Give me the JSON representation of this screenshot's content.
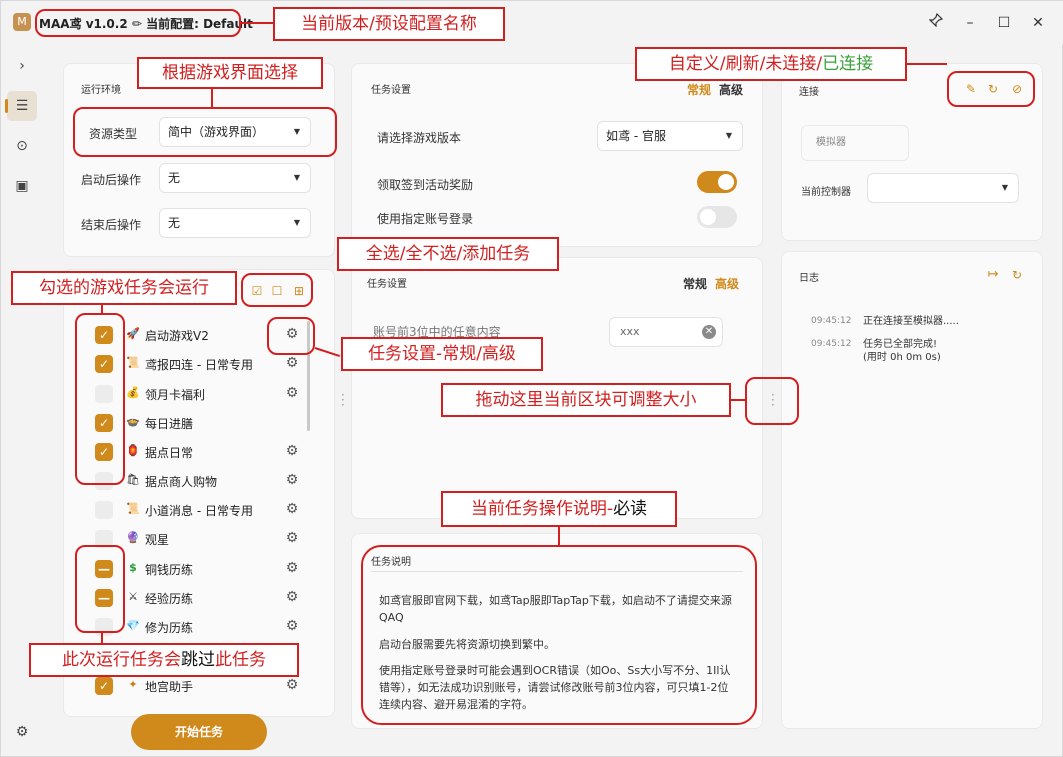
{
  "titlebar": {
    "logo_glyph": "M",
    "title": "MAA鸢  v1.0.2  ✏ 当前配置: Default",
    "pin_icon": "pin-icon",
    "min_glyph": "–",
    "max_glyph": "☐",
    "close_glyph": "✕"
  },
  "nav": {
    "expand_glyph": "›",
    "items": [
      {
        "icon": "task-list-icon",
        "glyph": "☰"
      },
      {
        "icon": "gamepad-icon",
        "glyph": "⊙"
      },
      {
        "icon": "screen-icon",
        "glyph": "▣"
      }
    ],
    "settings_glyph": "⚙"
  },
  "env": {
    "title": "运行环境",
    "resource_label": "资源类型",
    "resource_value": "简中（游戏界面）",
    "after_start_label": "启动后操作",
    "after_start_value": "无",
    "after_end_label": "结束后操作",
    "after_end_value": "无"
  },
  "task_settings_top": {
    "title": "任务设置",
    "mode_normal": "常规",
    "mode_advanced": "高级",
    "version_label": "请选择游戏版本",
    "version_value": "如鸢 - 官服",
    "reward_label": "领取签到活动奖励",
    "account_label": "使用指定账号登录"
  },
  "task_settings_bottom": {
    "title": "任务设置",
    "mode_normal": "常规",
    "mode_advanced": "高级",
    "account_prefix_label": "账号前3位中的任意内容",
    "account_prefix_value": "xxx"
  },
  "connection": {
    "title": "连接",
    "emulator": "模拟器",
    "controller_label": "当前控制器",
    "controller_value": ""
  },
  "log": {
    "title": "日志",
    "entries": [
      {
        "time": "09:45:12",
        "msg": "正在连接至模拟器....."
      },
      {
        "time": "09:45:12",
        "msg": "任务已全部完成!"
      }
    ],
    "sub_msg": "(用时 0h 0m 0s)"
  },
  "tasks": [
    {
      "name": "启动游戏V2",
      "state": "checked",
      "icon": "rocket-icon",
      "glyph": "🚀",
      "gear": true
    },
    {
      "name": "鸢报四连 - 日常专用",
      "state": "checked",
      "icon": "scroll-icon",
      "glyph": "📜",
      "gear": true
    },
    {
      "name": "领月卡福利",
      "state": "unchecked",
      "icon": "gift-icon",
      "glyph": "💰",
      "gear": true
    },
    {
      "name": "每日进膳",
      "state": "checked",
      "icon": "food-icon",
      "glyph": "🍲",
      "gear": false
    },
    {
      "name": "据点日常",
      "state": "checked",
      "icon": "lantern-icon",
      "glyph": "🏮",
      "gear": true
    },
    {
      "name": "据点商人购物",
      "state": "unchecked",
      "icon": "shop-icon",
      "glyph": "🛍",
      "gear": true
    },
    {
      "name": "小道消息 - 日常专用",
      "state": "unchecked",
      "icon": "note-icon",
      "glyph": "📜",
      "gear": true
    },
    {
      "name": "观星",
      "state": "unchecked",
      "icon": "star-icon",
      "glyph": "🔮",
      "gear": true
    },
    {
      "name": "铜钱历练",
      "state": "partial",
      "icon": "coin-icon",
      "glyph": "$",
      "gear": true
    },
    {
      "name": "经验历练",
      "state": "partial",
      "icon": "swords-icon",
      "glyph": "⚔",
      "gear": true
    },
    {
      "name": "修为历练",
      "state": "unchecked",
      "icon": "gem-icon",
      "glyph": "💎",
      "gear": true
    },
    {
      "name": "地宫助手",
      "state": "checked",
      "icon": "wand-icon",
      "glyph": "✦",
      "gear": true
    }
  ],
  "start_button": "开始任务",
  "description": {
    "title": "任务说明",
    "p1": "如鸢官服即官网下载，如鸢Tap服即TapTap下载，如启动不了请提交来源QAQ",
    "p2": "启动台服需要先将资源切换到繁中。",
    "p3": "使用指定账号登录时可能会遇到OCR错误（如Oo、Ss大小写不分、1Il认错等），如无法成功识别账号，请尝试修改账号前3位内容，可只填1-2位连续内容、避开易混淆的字符。"
  },
  "annotations": {
    "version": "当前版本/预设配置名称",
    "by_ui": "根据游戏界面选择",
    "conn_pre": "自定义/刷新/未连接/",
    "conn_green": "已连接",
    "select_all": "全选/全不选/添加任务",
    "checked_run": "勾选的游戏任务会运行",
    "task_settings": "任务设置-常规/高级",
    "resize": "拖动这里当前区块可调整大小",
    "desc_pre": "当前任务操作说明-",
    "desc_black": "必读",
    "skip_pre": "此次运行任务会",
    "skip_black": "跳过",
    "skip_post": "此任务"
  },
  "colors": {
    "accent": "#d08a1c",
    "annotation": "#d21f1f",
    "connected": "#3aa13a"
  }
}
